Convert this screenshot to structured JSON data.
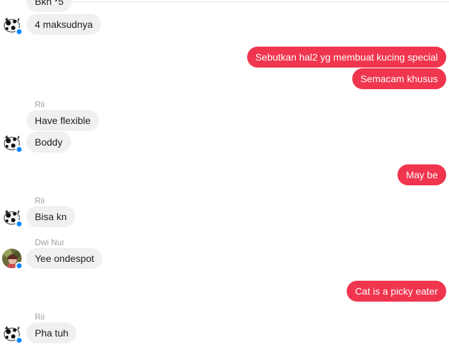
{
  "colors": {
    "outgoing": "#f0354e",
    "incoming": "#f1f0f0",
    "badge": "#0084ff"
  },
  "messages": [
    {
      "dir": "in",
      "text": "Bkn *5"
    },
    {
      "dir": "in",
      "text": "4 maksudnya"
    },
    {
      "dir": "out",
      "text": "Sebutkan hal2 yg membuat kucing special"
    },
    {
      "dir": "out",
      "text": "Semacam khusus"
    },
    {
      "dir": "in",
      "sender": "Rii",
      "text": "Have flexible"
    },
    {
      "dir": "in",
      "text": "Boddy"
    },
    {
      "dir": "out",
      "text": "May be"
    },
    {
      "dir": "in",
      "sender": "Rii",
      "text": "Bisa kn"
    },
    {
      "dir": "in",
      "sender": "Dwi Nur",
      "text": "Yee ondespot"
    },
    {
      "dir": "out",
      "text": "Cat is a picky eater"
    },
    {
      "dir": "in",
      "sender": "Rii",
      "text": "Pha tuh"
    }
  ],
  "avatars": [
    {
      "icon": "cow-avatar-icon"
    },
    {
      "icon": "cow-avatar-icon"
    },
    {
      "icon": "cow-avatar-icon"
    },
    {
      "icon": "photo-avatar-icon"
    },
    {
      "icon": "cow-avatar-icon"
    }
  ]
}
